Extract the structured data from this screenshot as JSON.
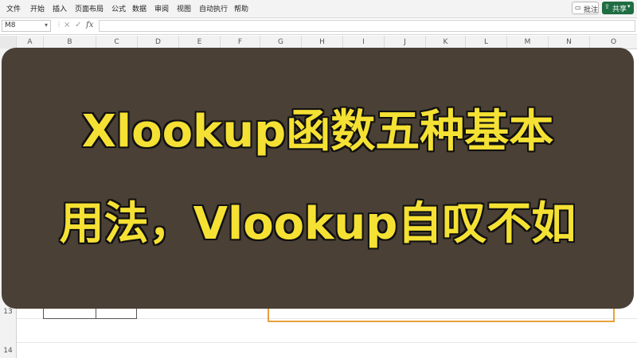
{
  "ribbon": {
    "tabs": [
      "文件",
      "开始",
      "插入",
      "页面布局",
      "公式",
      "数据",
      "审阅",
      "视图",
      "自动执行",
      "帮助"
    ],
    "comment_label": "批注",
    "share_label": "共享"
  },
  "formula_bar": {
    "name_box": "M8",
    "cancel_icon": "×",
    "confirm_icon": "✓",
    "fx_label": "fx",
    "formula": ""
  },
  "grid": {
    "columns": [
      "A",
      "B",
      "C",
      "D",
      "E",
      "F",
      "G",
      "H",
      "I",
      "J",
      "K",
      "L",
      "M",
      "N",
      "O"
    ],
    "rows": [
      "13",
      "14"
    ]
  },
  "overlay": {
    "title_line1": "Xlookup函数五种基本",
    "title_line2": "用法，Vlookup自叹不如"
  },
  "colors": {
    "overlay_bg": "#4a4036",
    "title_text": "#f5e133",
    "share_green": "#1f6d43",
    "selection_orange": "#e7a13b"
  }
}
